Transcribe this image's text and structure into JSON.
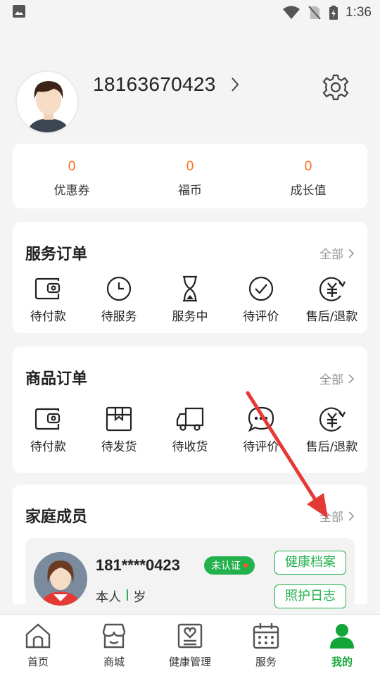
{
  "status_bar": {
    "time": "1:36"
  },
  "profile": {
    "phone": "18163670423"
  },
  "stats": [
    {
      "value": "0",
      "label": "优惠券"
    },
    {
      "value": "0",
      "label": "福币"
    },
    {
      "value": "0",
      "label": "成长值"
    }
  ],
  "service_orders": {
    "title": "服务订单",
    "more": "全部",
    "items": [
      {
        "label": "待付款",
        "icon": "wallet-icon"
      },
      {
        "label": "待服务",
        "icon": "clock-icon"
      },
      {
        "label": "服务中",
        "icon": "hourglass-icon"
      },
      {
        "label": "待评价",
        "icon": "check-circle-icon"
      },
      {
        "label": "售后/退款",
        "icon": "refund-icon"
      }
    ]
  },
  "goods_orders": {
    "title": "商品订单",
    "more": "全部",
    "items": [
      {
        "label": "待付款",
        "icon": "wallet-icon"
      },
      {
        "label": "待发货",
        "icon": "box-icon"
      },
      {
        "label": "待收货",
        "icon": "truck-icon"
      },
      {
        "label": "待评价",
        "icon": "chat-bubble-icon"
      },
      {
        "label": "售后/退款",
        "icon": "refund-icon"
      }
    ]
  },
  "family": {
    "title": "家庭成员",
    "more": "全部",
    "member": {
      "phone": "181****0423",
      "badge": "未认证",
      "relation": "本人",
      "age": "岁",
      "btn_health": "健康档案",
      "btn_care": "照护日志"
    }
  },
  "bottom_nav": [
    {
      "label": "首页",
      "icon": "home-icon"
    },
    {
      "label": "商城",
      "icon": "shop-icon"
    },
    {
      "label": "健康管理",
      "icon": "health-record-icon"
    },
    {
      "label": "服务",
      "icon": "calendar-icon"
    },
    {
      "label": "我的",
      "icon": "person-icon",
      "active": true
    }
  ],
  "colors": {
    "accent": "#13a538",
    "highlight": "#ff6a1a",
    "annotation_arrow": "#e53935"
  }
}
